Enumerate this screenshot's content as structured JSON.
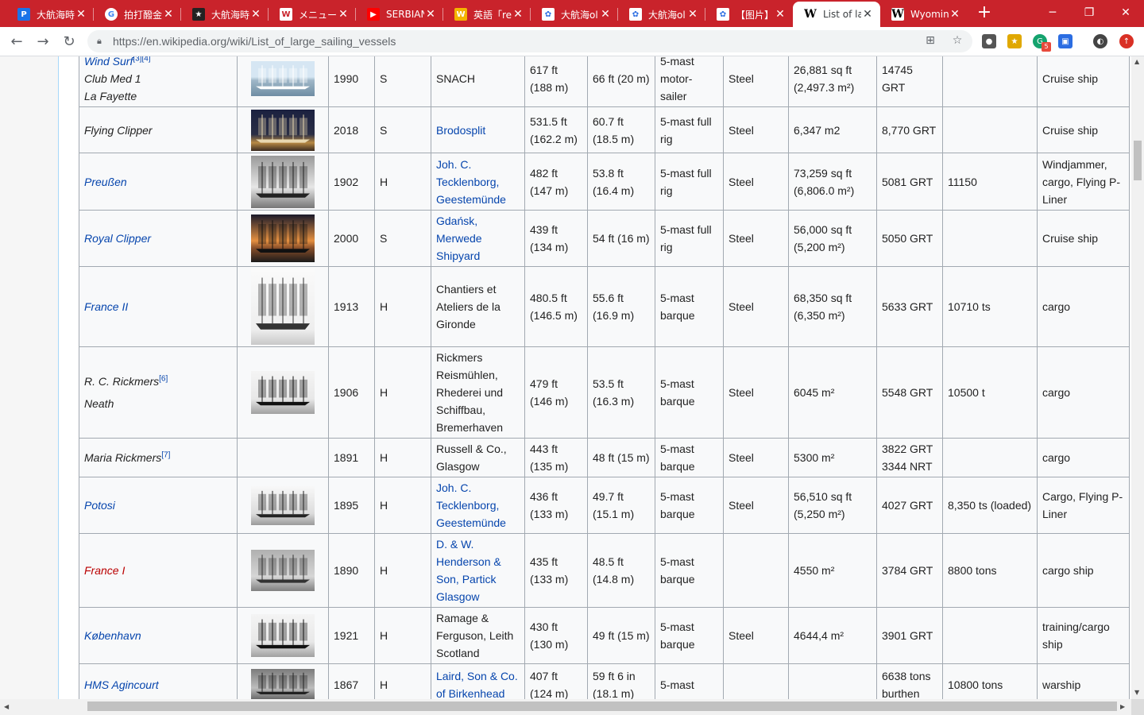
{
  "browser": {
    "tabs": [
      {
        "title": "大航海時代",
        "icon": "P",
        "icon_bg": "#1a73e8"
      },
      {
        "title": "拍打醱金",
        "icon": "G",
        "icon_bg": "#ffffff"
      },
      {
        "title": "大航海時代",
        "icon": "★",
        "icon_bg": "#222222"
      },
      {
        "title": "メニュー |",
        "icon": "W",
        "icon_bg": "#ffffff"
      },
      {
        "title": "SERBIAN",
        "icon": "▶",
        "icon_bg": "#ff0000"
      },
      {
        "title": "英語「ren",
        "icon": "W",
        "icon_bg": "#f4b400"
      },
      {
        "title": "大航海ol",
        "icon": "✿",
        "icon_bg": "#2b6de2"
      },
      {
        "title": "大航海ol",
        "icon": "✿",
        "icon_bg": "#2b6de2"
      },
      {
        "title": "【图片】历",
        "icon": "✿",
        "icon_bg": "#2b6de2"
      },
      {
        "title": "List of la",
        "icon": "W",
        "icon_bg": "#ffffff"
      },
      {
        "title": "Wyomin",
        "icon": "W",
        "icon_bg": "#ffffff"
      }
    ],
    "url": "https://en.wikipedia.org/wiki/List_of_large_sailing_vessels",
    "new_tab": "+",
    "extension_badge": "5"
  },
  "rows": [
    {
      "name_lines": [
        "Wind Surf",
        "Club Med 1",
        "La Fayette"
      ],
      "name_link": true,
      "sup": "[3][4]",
      "image": "motor-sailer",
      "year": "1990",
      "s": "S",
      "builder": "SNACH",
      "builder_link": false,
      "length": "617 ft (188 m)",
      "beam": "66 ft (20 m)",
      "rig": "5-mast motor-sailer",
      "hull": "Steel",
      "sail": "26,881 sq ft (2,497.3 m²)",
      "tonnage": "14745 GRT",
      "disp": "",
      "use": "Cruise ship"
    },
    {
      "name_lines": [
        "Flying Clipper"
      ],
      "name_link": false,
      "sup": "",
      "image": "night-rig",
      "year": "2018",
      "s": "S",
      "builder": "Brodosplit",
      "builder_link": true,
      "length": "531.5 ft (162.2 m)",
      "beam": "60.7 ft (18.5 m)",
      "rig": "5-mast full rig",
      "hull": "Steel",
      "sail": "6,347 m2",
      "tonnage": "8,770 GRT",
      "disp": "",
      "use": "Cruise ship"
    },
    {
      "name_lines": [
        "Preußen"
      ],
      "name_link": true,
      "sup": "",
      "image": "bw-deck",
      "year": "1902",
      "s": "H",
      "builder": "Joh. C. Tecklenborg, Geestemünde",
      "builder_link": true,
      "length": "482 ft (147 m)",
      "beam": "53.8 ft (16.4 m)",
      "rig": "5-mast full rig",
      "hull": "Steel",
      "sail": "73,259 sq ft (6,806.0 m²)",
      "tonnage": "5081 GRT",
      "disp": "11150",
      "use": "Windjammer, cargo, Flying P-Liner"
    },
    {
      "name_lines": [
        "Royal Clipper"
      ],
      "name_link": true,
      "sup": "",
      "image": "sunset",
      "year": "2000",
      "s": "S",
      "builder": "Gdańsk, Merwede Shipyard",
      "builder_link": true,
      "length": "439 ft (134 m)",
      "beam": "54 ft (16 m)",
      "rig": "5-mast full rig",
      "hull": "Steel",
      "sail": "56,000 sq ft (5,200 m²)",
      "tonnage": "5050 GRT",
      "disp": "",
      "use": "Cruise ship"
    },
    {
      "name_lines": [
        "France II"
      ],
      "name_link": true,
      "sup": "",
      "image": "drawing-tall",
      "year": "1913",
      "s": "H",
      "builder": "Chantiers et Ateliers de la Gironde",
      "builder_link": false,
      "length": "480.5 ft (146.5 m)",
      "beam": "55.6 ft (16.9 m)",
      "rig": "5-mast barque",
      "hull": "Steel",
      "sail": "68,350 sq ft (6,350 m²)",
      "tonnage": "5633 GRT",
      "disp": "10710 ts",
      "use": "cargo"
    },
    {
      "name_lines": [
        "R. C. Rickmers",
        "Neath"
      ],
      "name_link": false,
      "sup": "[6]",
      "image": "bw-profile",
      "year": "1906",
      "s": "H",
      "builder": "Rickmers Reismühlen, Rhederei und Schiffbau, Bremerhaven",
      "builder_link": false,
      "length": "479 ft (146 m)",
      "beam": "53.5 ft (16.3 m)",
      "rig": "5-mast barque",
      "hull": "Steel",
      "sail": "6045 m²",
      "tonnage": "5548 GRT",
      "disp": "10500 t",
      "use": "cargo"
    },
    {
      "name_lines": [
        "Maria Rickmers"
      ],
      "name_link": false,
      "sup": "[7]",
      "image": "",
      "year": "1891",
      "s": "H",
      "builder": "Russell & Co., Glasgow",
      "builder_link": false,
      "length": "443 ft (135 m)",
      "beam": "48 ft (15 m)",
      "rig": "5-mast barque",
      "hull": "Steel",
      "sail": "5300 m²",
      "tonnage": "3822 GRT 3344 NRT",
      "disp": "",
      "use": "cargo"
    },
    {
      "name_lines": [
        "Potosi"
      ],
      "name_link": true,
      "sup": "",
      "image": "bw-sail",
      "year": "1895",
      "s": "H",
      "builder": "Joh. C. Tecklenborg, Geestemünde",
      "builder_link": true,
      "length": "436 ft (133 m)",
      "beam": "49.7 ft (15.1 m)",
      "rig": "5-mast barque",
      "hull": "Steel",
      "sail": "56,510 sq ft (5,250 m²)",
      "tonnage": "4027 GRT",
      "disp": "8,350 ts (loaded)",
      "use": "Cargo, Flying P-Liner"
    },
    {
      "name_lines": [
        "France I"
      ],
      "name_link": true,
      "name_new": true,
      "sup": "",
      "image": "grey-photo",
      "year": "1890",
      "s": "H",
      "builder": "D. & W. Henderson & Son, Partick Glasgow",
      "builder_link": true,
      "length": "435 ft (133 m)",
      "beam": "48.5 ft (14.8 m)",
      "rig": "5-mast barque",
      "hull": "",
      "sail": "4550 m²",
      "tonnage": "3784 GRT",
      "disp": "8800 tons",
      "use": "cargo ship"
    },
    {
      "name_lines": [
        "København"
      ],
      "name_link": true,
      "sup": "",
      "image": "bw-profile",
      "year": "1921",
      "s": "H",
      "builder": "Ramage & Ferguson, Leith Scotland",
      "builder_link": false,
      "length": "430 ft (130 m)",
      "beam": "49 ft (15 m)",
      "rig": "5-mast barque",
      "hull": "Steel",
      "sail": "4644,4 m²",
      "tonnage": "3901 GRT",
      "disp": "",
      "use": "training/cargo ship"
    },
    {
      "name_lines": [
        "HMS Agincourt"
      ],
      "name_link": true,
      "sup": "",
      "image": "old-photo",
      "year": "1867",
      "s": "H",
      "builder": "Laird, Son & Co. of Birkenhead",
      "builder_link": true,
      "length": "407 ft (124 m)",
      "beam": "59 ft 6 in (18.1 m)",
      "rig": "5-mast",
      "hull": "",
      "sail": "",
      "tonnage": "6638 tons burthen",
      "disp": "10800 tons",
      "use": "warship"
    }
  ]
}
